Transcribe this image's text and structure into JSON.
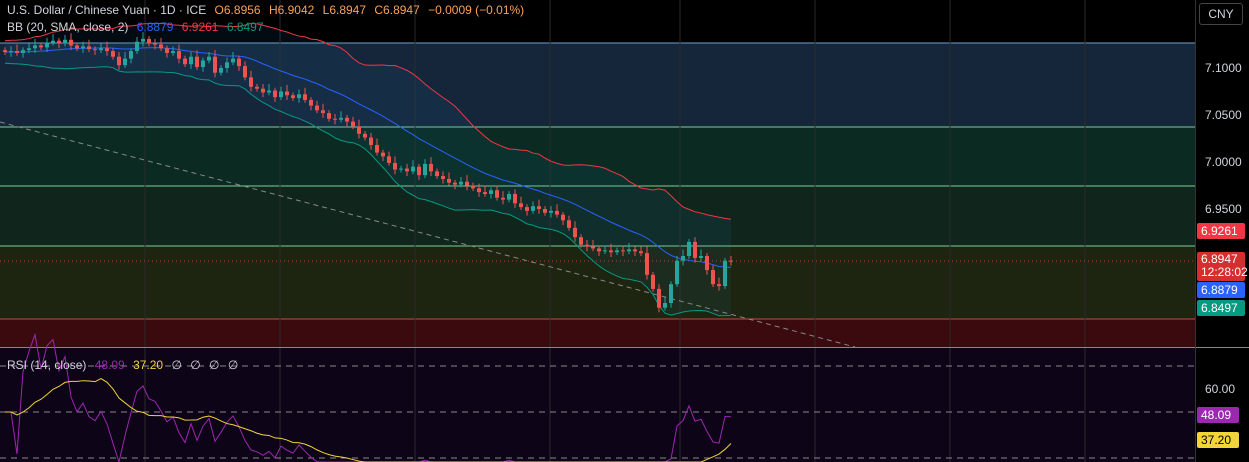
{
  "header": {
    "symbol": "U.S. Dollar / Chinese Yuan · 1D · ICE",
    "open": "O6.8956",
    "high": "H6.9042",
    "low": "L6.8947",
    "close": "C6.8947",
    "change": "−0.0009 (−0.01%)"
  },
  "bb": {
    "label": "BB (20, SMA, close, 2)",
    "basis": "6.8879",
    "upper": "6.9261",
    "lower": "6.8497"
  },
  "rsi": {
    "label": "RSI (14, close)",
    "value": "48.09",
    "ma": "37.20",
    "extras": [
      "∅",
      "∅",
      "∅",
      "∅"
    ],
    "axis_label": "60.00"
  },
  "price_axis": {
    "currency": "CNY",
    "labels": [
      "7.1000",
      "7.0500",
      "7.0000",
      "6.9500"
    ],
    "last_price": "6.8947",
    "countdown": "12:28:02"
  },
  "colors": {
    "up": "#26a69a",
    "down": "#ef5350",
    "basis": "#2962ff",
    "upper": "#f23645",
    "lower": "#089981",
    "rsi": "#9c27b0",
    "rsi_ma": "#f0d43a"
  },
  "chart_data": {
    "type": "candlestick",
    "ylim": [
      6.8,
      7.14
    ],
    "closes": [
      7.117,
      7.118,
      7.116,
      7.119,
      7.121,
      7.124,
      7.122,
      7.127,
      7.129,
      7.126,
      7.13,
      7.124,
      7.121,
      7.123,
      7.12,
      7.119,
      7.121,
      7.118,
      7.112,
      7.103,
      7.11,
      7.118,
      7.128,
      7.131,
      7.126,
      7.125,
      7.121,
      7.116,
      7.118,
      7.11,
      7.104,
      7.112,
      7.101,
      7.108,
      7.112,
      7.095,
      7.1,
      7.106,
      7.11,
      7.102,
      7.09,
      7.08,
      7.078,
      7.074,
      7.076,
      7.069,
      7.075,
      7.071,
      7.068,
      7.072,
      7.066,
      7.06,
      7.055,
      7.052,
      7.046,
      7.045,
      7.047,
      7.043,
      7.038,
      7.03,
      7.026,
      7.018,
      7.01,
      7.006,
      6.999,
      6.992,
      6.993,
      6.99,
      6.995,
      6.986,
      6.998,
      6.99,
      6.985,
      6.982,
      6.978,
      6.976,
      6.979,
      6.975,
      6.972,
      6.968,
      6.966,
      6.97,
      6.962,
      6.96,
      6.966,
      6.956,
      6.952,
      6.948,
      6.953,
      6.95,
      6.946,
      6.948,
      6.944,
      6.938,
      6.93,
      6.92,
      6.912,
      6.91,
      6.908,
      6.905,
      6.906,
      6.904,
      6.906,
      6.905,
      6.907,
      6.905,
      6.903,
      6.88,
      6.865,
      6.845,
      6.85,
      6.87,
      6.895,
      6.9,
      6.915,
      6.898,
      6.9,
      6.885,
      6.87,
      6.868,
      6.895,
      6.8947
    ]
  }
}
